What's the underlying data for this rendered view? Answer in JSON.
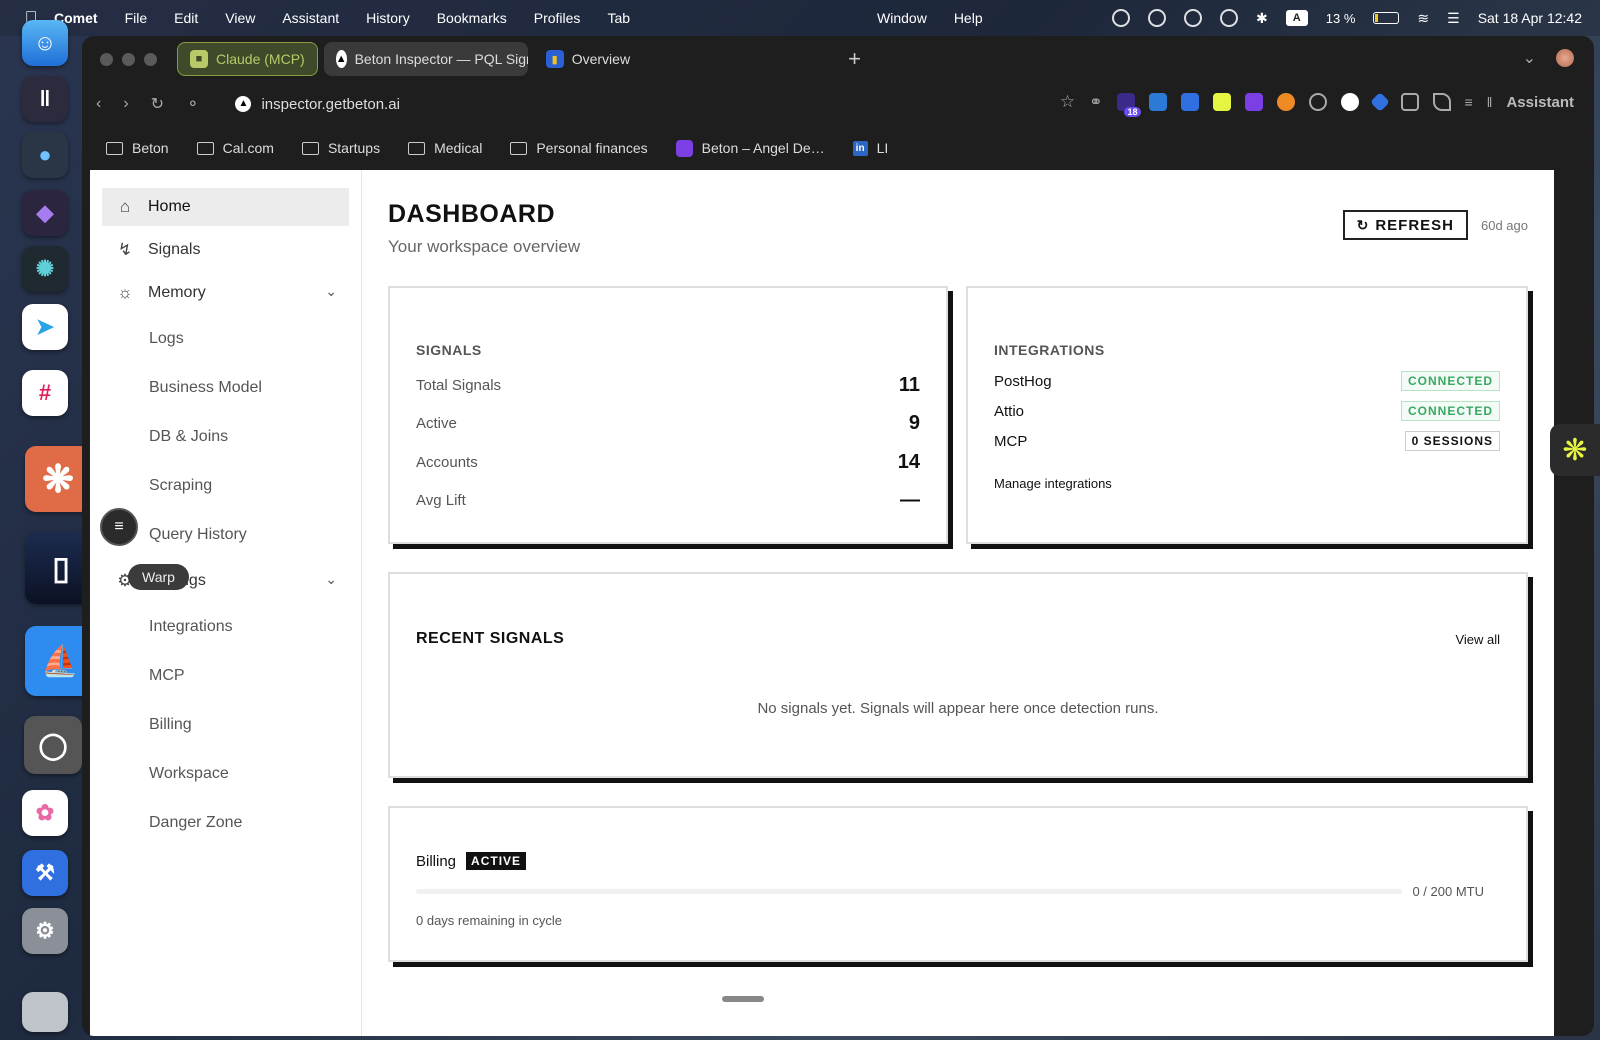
{
  "menubar": {
    "app": "Comet",
    "items": [
      "File",
      "Edit",
      "View",
      "Assistant",
      "History",
      "Bookmarks",
      "Profiles",
      "Tab",
      "Window",
      "Help"
    ],
    "battery": "13 %",
    "datetime": "Sat 18 Apr  12:42",
    "input_source": "A"
  },
  "dock": {
    "tooltip": "Warp"
  },
  "browser": {
    "tabs": [
      {
        "label": "Claude (MCP)"
      },
      {
        "label": "Beton Inspector — PQL Sign"
      },
      {
        "label": "Overview"
      }
    ],
    "new_tab": "+",
    "url": "inspector.getbeton.ai",
    "assistant_label": "Assistant",
    "ext_badge": "18",
    "bookmarks": [
      {
        "label": "Beton"
      },
      {
        "label": "Cal.com"
      },
      {
        "label": "Startups"
      },
      {
        "label": "Medical"
      },
      {
        "label": "Personal finances"
      },
      {
        "label": "Beton – Angel De…"
      },
      {
        "label": "LI"
      }
    ]
  },
  "sidebar": {
    "items": [
      {
        "label": "Home"
      },
      {
        "label": "Signals"
      },
      {
        "label": "Memory"
      },
      {
        "label": "Settings"
      }
    ],
    "memory_sub": [
      "Logs",
      "Business Model",
      "DB & Joins",
      "Scraping",
      "Query History"
    ],
    "settings_sub": [
      "Integrations",
      "MCP",
      "Billing",
      "Workspace",
      "Danger Zone"
    ]
  },
  "dashboard": {
    "title": "DASHBOARD",
    "subtitle": "Your workspace overview",
    "refresh_label": "REFRESH",
    "last_updated": "60d ago"
  },
  "signals_card": {
    "title": "SIGNALS",
    "rows": [
      {
        "label": "Total Signals",
        "value": "11"
      },
      {
        "label": "Active",
        "value": "9"
      },
      {
        "label": "Accounts",
        "value": "14"
      },
      {
        "label": "Avg Lift",
        "value": "—"
      }
    ]
  },
  "integrations_card": {
    "title": "INTEGRATIONS",
    "rows": [
      {
        "name": "PostHog",
        "status": "CONNECTED"
      },
      {
        "name": "Attio",
        "status": "CONNECTED"
      },
      {
        "name": "MCP",
        "status": "0 SESSIONS"
      }
    ],
    "manage_link": "Manage integrations"
  },
  "recent_signals": {
    "title": "RECENT SIGNALS",
    "view_all": "View all",
    "empty_message": "No signals yet. Signals will appear here once detection runs."
  },
  "billing": {
    "title": "Billing",
    "status": "ACTIVE",
    "usage_text": "0 / 200 MTU",
    "usage_fraction": 0,
    "remaining": "0 days remaining in cycle"
  },
  "colors": {
    "accent_green": "#3aa862",
    "tab_group": "#b8c96a",
    "card_shadow": "#111111"
  }
}
